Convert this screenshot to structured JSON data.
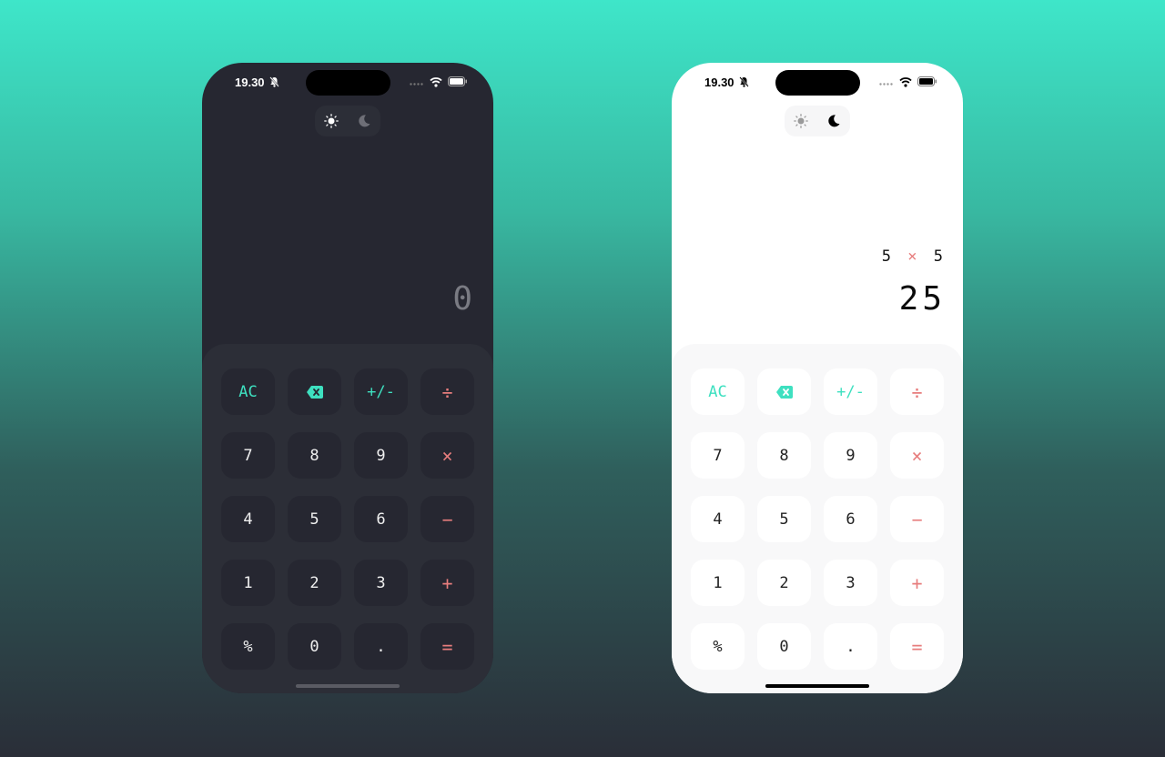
{
  "colors": {
    "accent": "#3ee0c0",
    "operator": "#e77d7d",
    "dark_bg": "#262731",
    "light_bg": "#ffffff"
  },
  "dark": {
    "status": {
      "time": "19.30"
    },
    "display": {
      "expression": "",
      "result": "0"
    },
    "keys": [
      {
        "label": "AC",
        "type": "accent"
      },
      {
        "label": "",
        "type": "accent",
        "icon": "backspace-icon"
      },
      {
        "label": "+/-",
        "type": "accent"
      },
      {
        "label": "÷",
        "type": "op"
      },
      {
        "label": "7",
        "type": "num"
      },
      {
        "label": "8",
        "type": "num"
      },
      {
        "label": "9",
        "type": "num"
      },
      {
        "label": "×",
        "type": "op"
      },
      {
        "label": "4",
        "type": "num"
      },
      {
        "label": "5",
        "type": "num"
      },
      {
        "label": "6",
        "type": "num"
      },
      {
        "label": "−",
        "type": "op"
      },
      {
        "label": "1",
        "type": "num"
      },
      {
        "label": "2",
        "type": "num"
      },
      {
        "label": "3",
        "type": "num"
      },
      {
        "label": "+",
        "type": "op"
      },
      {
        "label": "%",
        "type": "num"
      },
      {
        "label": "0",
        "type": "num"
      },
      {
        "label": ".",
        "type": "num"
      },
      {
        "label": "=",
        "type": "op"
      }
    ]
  },
  "light": {
    "status": {
      "time": "19.30"
    },
    "display": {
      "expression": {
        "left": "5",
        "operator": "×",
        "right": "5"
      },
      "result": "25"
    },
    "keys": [
      {
        "label": "AC",
        "type": "accent"
      },
      {
        "label": "",
        "type": "accent",
        "icon": "backspace-icon"
      },
      {
        "label": "+/-",
        "type": "accent"
      },
      {
        "label": "÷",
        "type": "op"
      },
      {
        "label": "7",
        "type": "num"
      },
      {
        "label": "8",
        "type": "num"
      },
      {
        "label": "9",
        "type": "num"
      },
      {
        "label": "×",
        "type": "op"
      },
      {
        "label": "4",
        "type": "num"
      },
      {
        "label": "5",
        "type": "num"
      },
      {
        "label": "6",
        "type": "num"
      },
      {
        "label": "−",
        "type": "op"
      },
      {
        "label": "1",
        "type": "num"
      },
      {
        "label": "2",
        "type": "num"
      },
      {
        "label": "3",
        "type": "num"
      },
      {
        "label": "+",
        "type": "op"
      },
      {
        "label": "%",
        "type": "num"
      },
      {
        "label": "0",
        "type": "num"
      },
      {
        "label": ".",
        "type": "num"
      },
      {
        "label": "=",
        "type": "op"
      }
    ]
  }
}
